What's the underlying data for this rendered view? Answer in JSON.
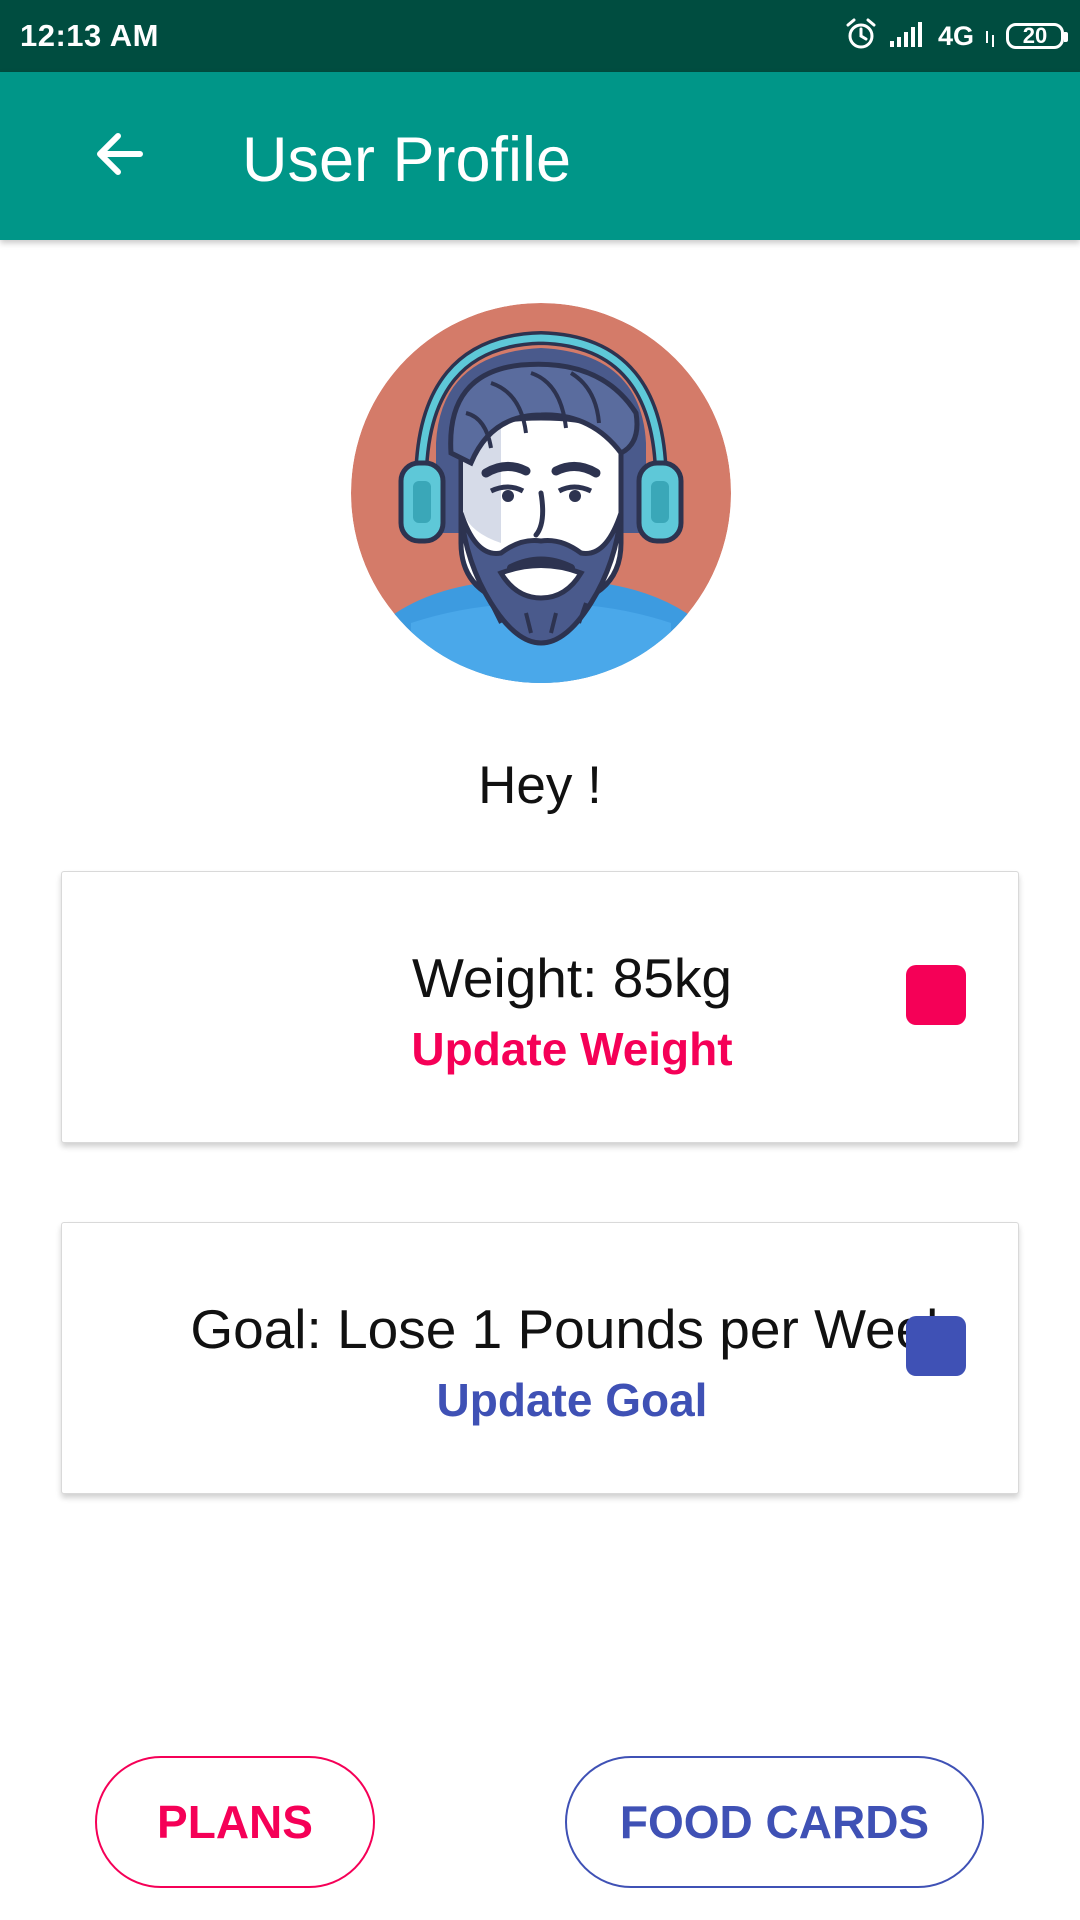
{
  "status_bar": {
    "time": "12:13 AM",
    "network": "4G",
    "battery": "20",
    "icons": [
      "alarm-icon",
      "signal-icon",
      "battery-icon"
    ]
  },
  "app_bar": {
    "title": "User Profile",
    "back_icon": "arrow-back-icon"
  },
  "profile": {
    "avatar": "bearded-man-with-headphones-avatar",
    "greeting": "Hey !"
  },
  "cards": {
    "weight": {
      "title": "Weight: 85kg",
      "action": "Update Weight",
      "color": "#f50057"
    },
    "goal": {
      "title": "Goal: Lose 1 Pounds per Week",
      "action": "Update Goal",
      "color": "#3f51b5"
    }
  },
  "buttons": {
    "plans": "PLANS",
    "food_cards": "FOOD CARDS"
  },
  "colors": {
    "status_bar": "#004d40",
    "app_bar": "#009688",
    "accent_pink": "#f50057",
    "accent_indigo": "#3f51b5"
  }
}
